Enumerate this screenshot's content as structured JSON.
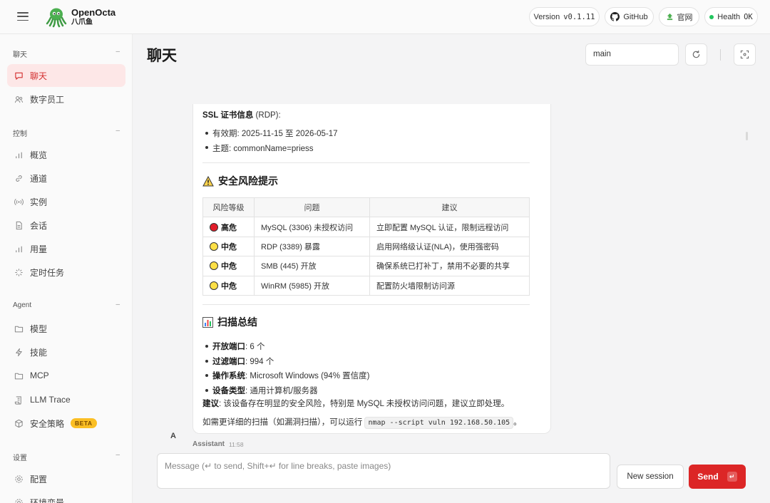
{
  "brand": {
    "name": "OpenOcta",
    "subtitle": "八爪鱼"
  },
  "header": {
    "version_label": "Version",
    "version_value": "v0.1.11",
    "github_label": "GitHub",
    "website_label": "官网",
    "health_label": "Health",
    "health_value": "OK"
  },
  "sidebar": {
    "sections": {
      "chat": "聊天",
      "control": "控制",
      "agent": "Agent",
      "settings": "设置"
    },
    "items": {
      "chat": "聊天",
      "digital_staff": "数字员工",
      "overview": "概览",
      "channels": "通道",
      "instances": "实例",
      "sessions": "会话",
      "usage": "用量",
      "cron": "定时任务",
      "models": "模型",
      "skills": "技能",
      "mcp": "MCP",
      "llm_trace": "LLM Trace",
      "security": "安全策略",
      "security_badge": "BETA",
      "config": "配置",
      "env": "环境变量"
    }
  },
  "main": {
    "title": "聊天",
    "session_value": "main"
  },
  "message": {
    "ssl_heading_bold": "SSL 证书信息",
    "ssl_heading_rest": " (RDP):",
    "ssl_items": [
      "有效期: 2025-11-15 至 2026-05-17",
      "主题: commonName=priess"
    ],
    "risk_heading": "安全风险提示",
    "risk_table": {
      "headers": [
        "风险等级",
        "问题",
        "建议"
      ],
      "rows": [
        {
          "level": "高危",
          "color": "#e11d2a",
          "issue": "MySQL (3306) 未授权访问",
          "advice": "立即配置 MySQL 认证，限制远程访问"
        },
        {
          "level": "中危",
          "color": "#fde047",
          "issue": "RDP (3389) 暴露",
          "advice": "启用网络级认证(NLA)，使用强密码"
        },
        {
          "level": "中危",
          "color": "#fde047",
          "issue": "SMB (445) 开放",
          "advice": "确保系统已打补丁，禁用不必要的共享"
        },
        {
          "level": "中危",
          "color": "#fde047",
          "issue": "WinRM (5985) 开放",
          "advice": "配置防火墙限制访问源"
        }
      ]
    },
    "summary_heading": "扫描总结",
    "summary_items": [
      {
        "label": "开放端口",
        "value": ": 6 个"
      },
      {
        "label": "过滤端口",
        "value": ": 994 个"
      },
      {
        "label": "操作系统",
        "value": ": Microsoft Windows (94% 置信度)"
      },
      {
        "label": "设备类型",
        "value": ": 通用计算机/服务器"
      }
    ],
    "advice_label": "建议",
    "advice_text": ": 该设备存在明显的安全风险，特别是 MySQL 未授权访问问题，建议立即处理。",
    "footer_text": "如需更详细的扫描（如漏洞扫描），可以运行",
    "footer_code": "nmap --script vuln 192.168.50.105",
    "footer_end": "。"
  },
  "assistant": {
    "avatar": "A",
    "label": "Assistant",
    "time": "11:58"
  },
  "composer": {
    "placeholder": "Message (↵ to send, Shift+↵ for line breaks, paste images)",
    "new_session": "New session",
    "send": "Send",
    "send_kbd": "↵"
  }
}
